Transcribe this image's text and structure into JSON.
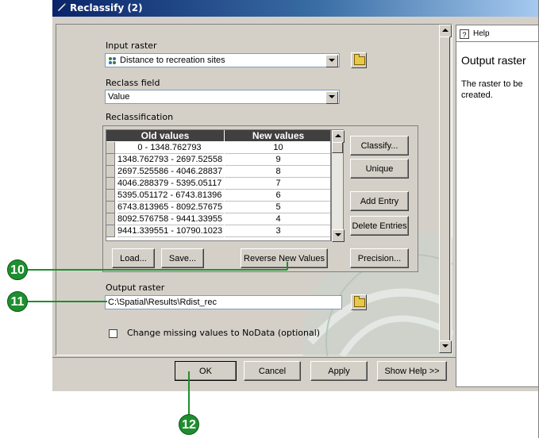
{
  "window": {
    "title": "Reclassify (2)"
  },
  "input_raster": {
    "label": "Input raster",
    "value": "Distance to recreation sites"
  },
  "reclass_field": {
    "label": "Reclass field",
    "value": "Value"
  },
  "reclassification": {
    "label": "Reclassification",
    "columns": [
      "Old values",
      "New values"
    ],
    "rows": [
      {
        "old": "0 - 1348.762793",
        "new": "10"
      },
      {
        "old": "1348.762793 - 2697.52558",
        "new": "9"
      },
      {
        "old": "2697.525586 - 4046.28837",
        "new": "8"
      },
      {
        "old": "4046.288379 - 5395.05117",
        "new": "7"
      },
      {
        "old": "5395.051172 - 6743.81396",
        "new": "6"
      },
      {
        "old": "6743.813965 - 8092.57675",
        "new": "5"
      },
      {
        "old": "8092.576758 - 9441.33955",
        "new": "4"
      },
      {
        "old": "9441.339551 - 10790.1023",
        "new": "3"
      }
    ],
    "buttons": {
      "classify": "Classify...",
      "unique": "Unique",
      "add_entry": "Add Entry",
      "delete_entries": "Delete Entries",
      "load": "Load...",
      "save": "Save...",
      "reverse": "Reverse New Values",
      "precision": "Precision..."
    }
  },
  "output_raster": {
    "label": "Output raster",
    "value": "C:\\Spatial\\Results\\Rdist_rec"
  },
  "nodata_checkbox": {
    "label": "Change missing values to NoData (optional)",
    "checked": false
  },
  "footer": {
    "ok": "OK",
    "cancel": "Cancel",
    "apply": "Apply",
    "show_help": "Show Help >>"
  },
  "help": {
    "button": "Help",
    "title": "Output raster",
    "text_line1": "The raster to be",
    "text_line2": "created."
  },
  "callouts": [
    "10",
    "11",
    "12"
  ],
  "colors": {
    "callout": "#1f8e2f",
    "title_bar": "#0a246a",
    "dialog": "#d4d0c8"
  }
}
